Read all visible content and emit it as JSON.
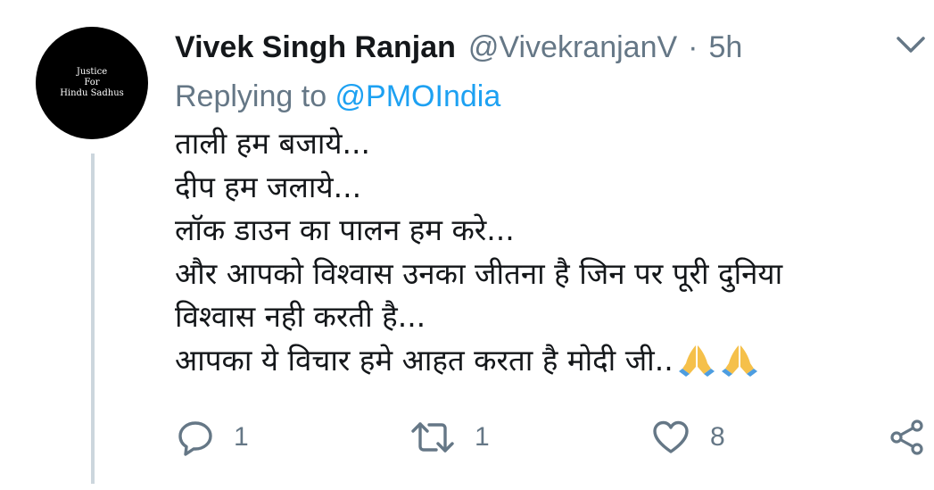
{
  "avatar": {
    "text_lines": [
      "Justice",
      "For",
      "Hindu Sadhus"
    ]
  },
  "tweet": {
    "author_name": "Vivek Singh Ranjan",
    "author_handle": "@VivekranjanV",
    "separator": "·",
    "timestamp": "5h",
    "replying_prefix": "Replying to ",
    "replying_to": "@PMOIndia",
    "body_lines": [
      "ताली हम बजाये...",
      "दीप हम जलाये...",
      "लॉक डाउन का पालन हम करे...",
      "और आपको विश्वास उनका जीतना है जिन पर पूरी दुनिया",
      "विश्वास नही करती है...",
      "आपका ये विचार हमे आहत करता है मोदी जी.."
    ],
    "emoji": "folded-hands-icon x2"
  },
  "actions": {
    "reply_count": "1",
    "retweet_count": "1",
    "like_count": "8"
  },
  "colors": {
    "primary_text": "#14171a",
    "secondary_text": "#657786",
    "link": "#1da1f2",
    "thread_line": "#ccd6dd"
  }
}
